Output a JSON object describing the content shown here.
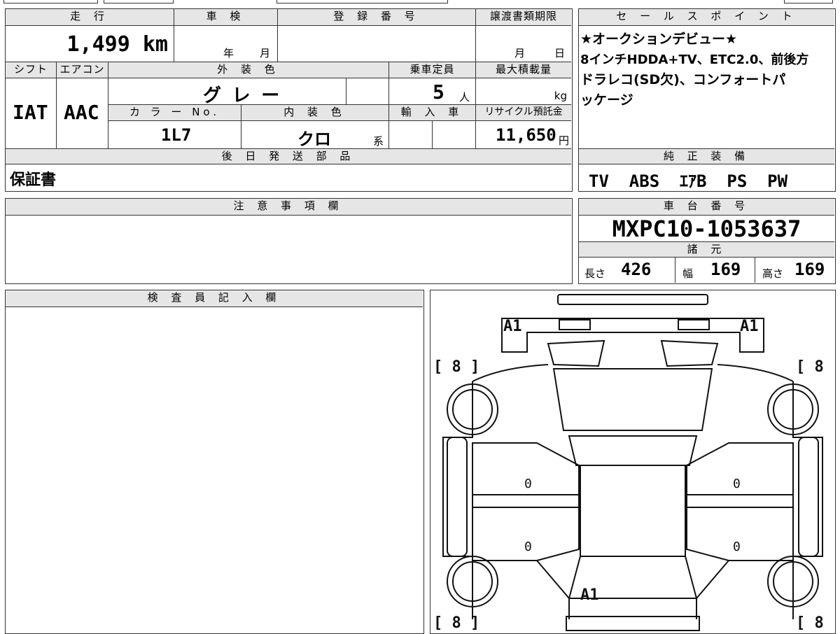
{
  "vehicle": {
    "mileage_label": "走 行",
    "mileage": "1,499",
    "mileage_unit": "km",
    "inspection_label": "車 検",
    "inspection_year": "年",
    "inspection_month": "月",
    "registration_label": "登 録 番 号",
    "registration": "",
    "transfer_label": "譲渡書類期限",
    "transfer_month": "月",
    "transfer_day": "日",
    "shift_label": "シフト",
    "shift": "IAT",
    "ac_label": "エアコン",
    "ac": "AAC",
    "exterior_label": "外 装 色",
    "exterior": "グ レ ー",
    "capacity_label": "乗車定員",
    "capacity": "5",
    "capacity_unit": "人",
    "max_load_label": "最大積載量",
    "max_load_unit": "kg",
    "color_no_label": "カ ラ ー No.",
    "color_no": "1L7",
    "interior_label": "内 装 色",
    "interior": "クロ",
    "interior_suffix": "系",
    "import_label": "輸 入 車",
    "recycle_label": "リサイクル預託金",
    "recycle": "11,650",
    "recycle_unit": "円",
    "later_parts_label": "後 日 発 送 部 品",
    "later_parts": "保証書",
    "notes_label": "注 意 事 項 欄",
    "inspector_label": "検 査 員 記 入 欄"
  },
  "sales": {
    "label": "セ ー ル ス ポ イ ン ト",
    "lines": [
      "★オークションデビュー★",
      "8インチHDDA+TV、ETC2.0、前後方",
      "ドラレコ(SD欠)、コンフォートパ",
      "ッケージ"
    ]
  },
  "equipment": {
    "label": "純 正 装 備",
    "items": "TV  ABS  ｴｱB  PS  PW"
  },
  "chassis": {
    "label": "車 台 番 号",
    "number": "MXPC10-1053637",
    "specs_label": "諸 元",
    "length_label": "長さ",
    "length": "426",
    "width_label": "幅",
    "width": "169",
    "height_label": "高さ",
    "height": "169"
  },
  "diagram": {
    "mark_front_left": "A1",
    "mark_front_right": "A1",
    "mark_rear": "A1",
    "tire_fl": "[ 8 ]",
    "tire_fr": "[ 8 ]",
    "tire_rl": "[ 8 ]",
    "tire_rr": "[ 8 ]",
    "door_fl": "0",
    "door_fr": "0",
    "door_rl": "0",
    "door_rr": "0"
  }
}
